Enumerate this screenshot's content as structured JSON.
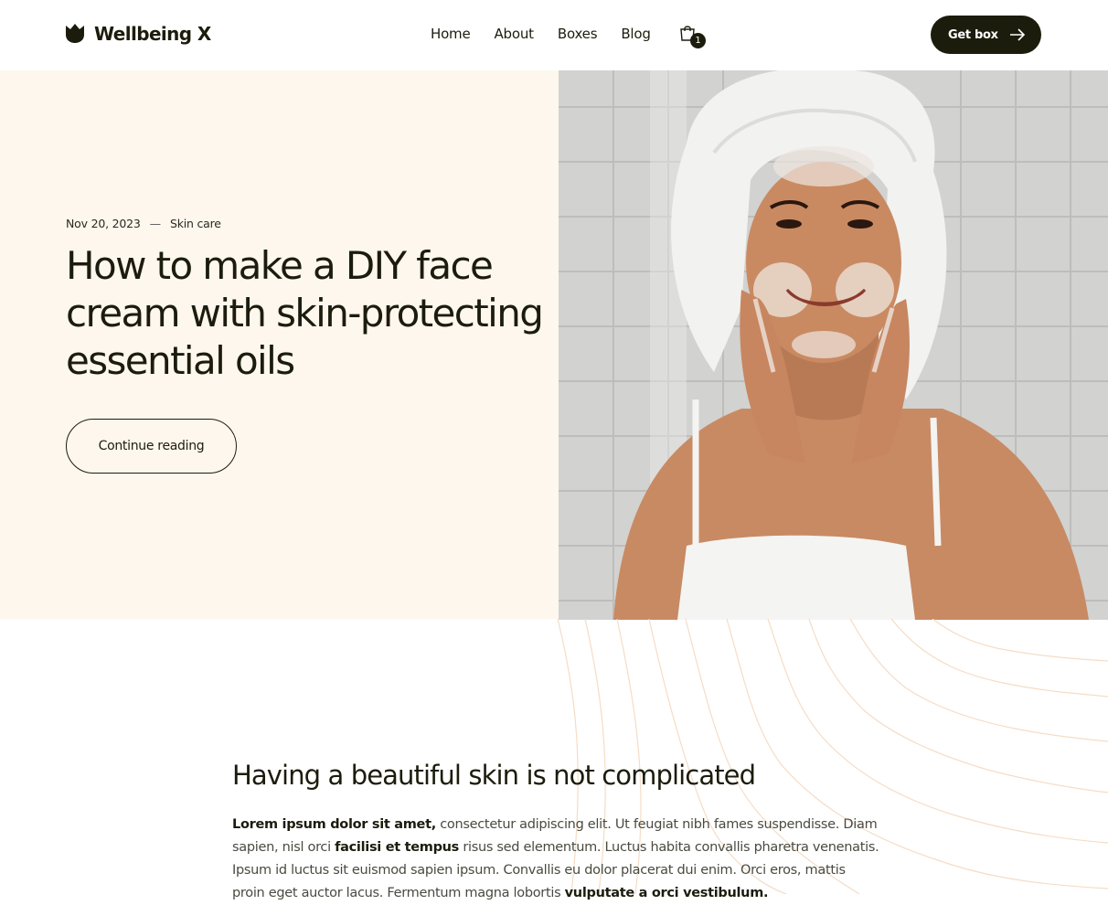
{
  "header": {
    "brand": "Wellbeing X",
    "nav": [
      {
        "label": "Home"
      },
      {
        "label": "About"
      },
      {
        "label": "Boxes"
      },
      {
        "label": "Blog"
      }
    ],
    "cart_count": "1",
    "cta_label": "Get box"
  },
  "hero": {
    "date": "Nov 20, 2023",
    "separator": "—",
    "category": "Skin care",
    "title": "How to make a DIY face cream with skin-protecting essential oils",
    "button_label": "Continue reading"
  },
  "content": {
    "heading": "Having a beautiful skin is not complicated",
    "body": [
      {
        "text": "Lorem ipsum dolor sit amet,",
        "bold": true
      },
      {
        "text": " consectetur adipiscing elit. Ut feugiat nibh fames suspendisse. Diam sapien, nisl orci ",
        "bold": false
      },
      {
        "text": "facilisi et tempus",
        "bold": true
      },
      {
        "text": " risus sed elementum. Luctus habita convallis pharetra venenatis. Ipsum id luctus sit euismod sapien ipsum. Convallis eu dolor placerat dui enim. Orci eros, mattis proin eget auctor lacus. Fermentum magna lobortis ",
        "bold": false
      },
      {
        "text": "vulputate a orci vestibulum.",
        "bold": true
      }
    ]
  },
  "colors": {
    "ink": "#1c1c0d",
    "hero_bg": "#fef7ee",
    "pattern_stroke": "#f5dcc6"
  },
  "icons": {
    "logo": "tulip-logo-icon",
    "cart": "shopping-bag-icon",
    "cta": "arrow-right-icon"
  }
}
